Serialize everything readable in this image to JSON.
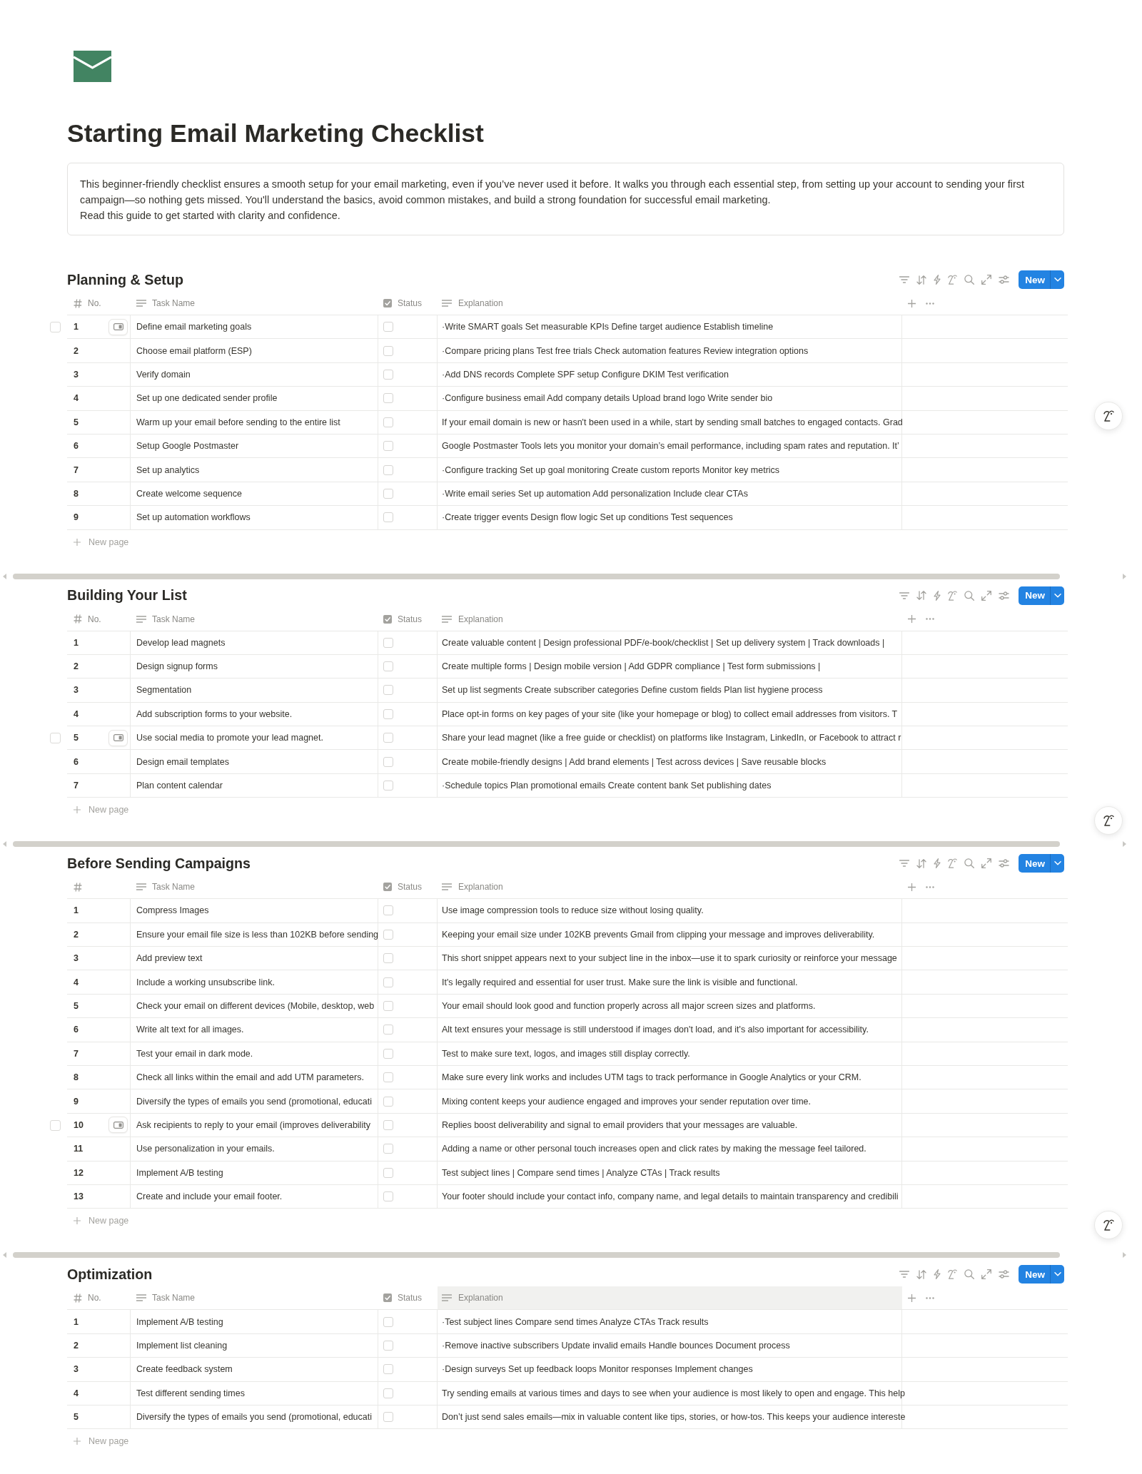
{
  "page": {
    "title": "Starting Email Marketing Checklist",
    "description": [
      "This beginner-friendly checklist ensures a smooth setup for your email marketing, even if you’ve never used it before. It walks you through each essential step, from setting up your account to sending your first campaign—so nothing gets missed. You'll understand the basics, avoid common mistakes, and build a strong foundation for successful email marketing.",
      "Read this guide to get started with clarity and confidence."
    ]
  },
  "tables": [
    {
      "title": "Planning & Setup",
      "new_button": "New",
      "new_page": "New page",
      "columns": [
        {
          "kind": "number",
          "label": "No.",
          "hovered": false
        },
        {
          "kind": "text",
          "label": "Task Name",
          "hovered": false
        },
        {
          "kind": "checkbox",
          "label": "Status",
          "hovered": false
        },
        {
          "kind": "text",
          "label": "Explanation",
          "hovered": false
        }
      ],
      "rows": [
        {
          "no": "1",
          "task": "Define email marketing goals",
          "checked": false,
          "selected": false,
          "explanation": "·Write SMART goals Set measurable KPIs Define target audience Establish timeline",
          "hovered": true
        },
        {
          "no": "2",
          "task": "Choose email platform (ESP)",
          "checked": false,
          "selected": false,
          "explanation": "·Compare pricing plans Test free trials Check automation features Review integration options",
          "hovered": false
        },
        {
          "no": "3",
          "task": "Verify domain",
          "checked": false,
          "selected": false,
          "explanation": "·Add DNS records Complete SPF setup Configure DKIM Test verification",
          "hovered": false
        },
        {
          "no": "4",
          "task": "Set up one dedicated sender profile",
          "checked": false,
          "selected": false,
          "explanation": "·Configure business email Add company details Upload brand logo Write sender bio",
          "hovered": false
        },
        {
          "no": "5",
          "task": "Warm up your email before sending to the entire list",
          "checked": false,
          "selected": false,
          "explanation": "If your email domain is new or hasn't been used in a while, start by sending small batches to engaged contacts. Grad",
          "hovered": false
        },
        {
          "no": "6",
          "task": "Setup Google Postmaster",
          "checked": false,
          "selected": false,
          "explanation": "Google Postmaster Tools lets you monitor your domain’s email performance, including spam rates and reputation. It’",
          "hovered": false
        },
        {
          "no": "7",
          "task": "Set up analytics",
          "checked": false,
          "selected": false,
          "explanation": "·Configure tracking Set up goal monitoring Create custom reports Monitor key metrics",
          "hovered": false
        },
        {
          "no": "8",
          "task": "Create welcome sequence",
          "checked": false,
          "selected": false,
          "explanation": "·Write email series Set up automation Add personalization Include clear CTAs",
          "hovered": false
        },
        {
          "no": "9",
          "task": "Set up automation workflows",
          "checked": false,
          "selected": false,
          "explanation": "·Create trigger events Design flow logic Set up conditions Test sequences",
          "hovered": false
        }
      ]
    },
    {
      "title": "Building Your List",
      "new_button": "New",
      "new_page": "New page",
      "columns": [
        {
          "kind": "number",
          "label": "No.",
          "hovered": false
        },
        {
          "kind": "text",
          "label": "Task Name",
          "hovered": false
        },
        {
          "kind": "checkbox",
          "label": "Status",
          "hovered": false
        },
        {
          "kind": "text",
          "label": "Explanation",
          "hovered": false
        }
      ],
      "rows": [
        {
          "no": "1",
          "task": "Develop lead magnets",
          "checked": false,
          "selected": false,
          "explanation": "Create valuable content | Design professional PDF/e-book/checklist | Set up delivery system | Track downloads |",
          "hovered": false
        },
        {
          "no": "2",
          "task": "Design signup forms",
          "checked": false,
          "selected": false,
          "explanation": "Create multiple forms | Design mobile version | Add GDPR compliance | Test form submissions |",
          "hovered": false
        },
        {
          "no": "3",
          "task": "Segmentation",
          "checked": false,
          "selected": false,
          "explanation": "Set up list segments Create subscriber categories Define custom fields Plan list hygiene process",
          "hovered": false
        },
        {
          "no": "4",
          "task": "Add subscription forms to your website.",
          "checked": false,
          "selected": false,
          "explanation": "Place opt-in forms on key pages of your site (like your homepage or blog) to collect email addresses from visitors. T",
          "hovered": false
        },
        {
          "no": "5",
          "task": "Use social media to promote your lead magnet.",
          "checked": false,
          "selected": false,
          "explanation": "Share your lead magnet (like a free guide or checklist) on platforms like Instagram, LinkedIn, or Facebook to attract r",
          "hovered": true
        },
        {
          "no": "6",
          "task": "Design email templates",
          "checked": false,
          "selected": false,
          "explanation": "Create mobile-friendly designs | Add brand elements | Test across devices | Save reusable blocks",
          "hovered": false
        },
        {
          "no": "7",
          "task": "Plan content calendar",
          "checked": false,
          "selected": false,
          "explanation": "·Schedule topics Plan promotional emails Create content bank Set publishing dates",
          "hovered": false
        }
      ]
    },
    {
      "title": "Before Sending Campaigns",
      "new_button": "New",
      "new_page": "New page",
      "columns": [
        {
          "kind": "number",
          "hovered": false
        },
        {
          "kind": "text",
          "label": "Task Name",
          "hovered": false
        },
        {
          "kind": "checkbox",
          "label": "Status",
          "hovered": false
        },
        {
          "kind": "text",
          "label": "Explanation",
          "hovered": false
        }
      ],
      "rows": [
        {
          "no": "1",
          "task": "Compress Images",
          "checked": false,
          "selected": false,
          "explanation": "Use image compression tools to reduce size without losing quality.",
          "hovered": false
        },
        {
          "no": "2",
          "task": "Ensure your email file size is less than 102KB before sending",
          "checked": false,
          "selected": false,
          "explanation": "Keeping your email size under 102KB prevents Gmail from clipping your message and improves deliverability.",
          "hovered": false
        },
        {
          "no": "3",
          "task": "Add preview text",
          "checked": false,
          "selected": false,
          "explanation": "This short snippet appears next to your subject line in the inbox—use it to spark curiosity or reinforce your message",
          "hovered": false
        },
        {
          "no": "4",
          "task": "Include a working unsubscribe link.",
          "checked": false,
          "selected": false,
          "explanation": "It's legally required and essential for user trust. Make sure the link is visible and functional.",
          "hovered": false
        },
        {
          "no": "5",
          "task": "Check your email on different devices (Mobile, desktop, web",
          "checked": false,
          "selected": false,
          "explanation": "Your email should look good and function properly across all major screen sizes and platforms.",
          "hovered": false
        },
        {
          "no": "6",
          "task": "Write alt text for all images.",
          "checked": false,
          "selected": false,
          "explanation": "Alt text ensures your message is still understood if images don't load, and it's also important for accessibility.",
          "hovered": false
        },
        {
          "no": "7",
          "task": "Test your email in dark mode.",
          "checked": false,
          "selected": false,
          "explanation": "Test to make sure text, logos, and images still display correctly.",
          "hovered": false
        },
        {
          "no": "8",
          "task": "Check all links within the email and add UTM parameters.",
          "checked": false,
          "selected": false,
          "explanation": "Make sure every link works and includes UTM tags to track performance in Google Analytics or your CRM.",
          "hovered": false
        },
        {
          "no": "9",
          "task": "Diversify the types of emails you send (promotional, educati",
          "checked": false,
          "selected": false,
          "explanation": "Mixing content keeps your audience engaged and improves your sender reputation over time.",
          "hovered": false
        },
        {
          "no": "10",
          "task": "Ask recipients to reply to your email (improves deliverability",
          "checked": false,
          "selected": false,
          "explanation": "Replies boost deliverability and signal to email providers that your messages are valuable.",
          "hovered": true
        },
        {
          "no": "11",
          "task": "Use personalization in your emails.",
          "checked": false,
          "selected": false,
          "explanation": "Adding a name or other personal touch increases open and click rates by making the message feel tailored.",
          "hovered": false
        },
        {
          "no": "12",
          "task": "Implement A/B testing",
          "checked": false,
          "selected": false,
          "explanation": "Test subject lines | Compare send times | Analyze CTAs | Track results",
          "hovered": false
        },
        {
          "no": "13",
          "task": "Create and include your email footer.",
          "checked": false,
          "selected": false,
          "explanation": "Your footer should include your contact info, company name, and legal details to maintain transparency and credibili",
          "hovered": false
        }
      ]
    },
    {
      "title": "Optimization",
      "new_button": "New",
      "new_page": "New page",
      "columns": [
        {
          "kind": "number",
          "label": "No.",
          "hovered": false
        },
        {
          "kind": "text",
          "label": "Task Name",
          "hovered": false
        },
        {
          "kind": "checkbox",
          "label": "Status",
          "hovered": false
        },
        {
          "kind": "text",
          "label": "Explanation",
          "hovered": true
        }
      ],
      "rows": [
        {
          "no": "1",
          "task": "Implement A/B testing",
          "checked": false,
          "selected": false,
          "explanation": "·Test subject lines Compare send times Analyze CTAs Track results",
          "hovered": false
        },
        {
          "no": "2",
          "task": "Implement list cleaning",
          "checked": false,
          "selected": false,
          "explanation": "·Remove inactive subscribers Update invalid emails Handle bounces Document process",
          "hovered": false
        },
        {
          "no": "3",
          "task": "Create feedback system",
          "checked": false,
          "selected": false,
          "explanation": "·Design surveys Set up feedback loops Monitor responses Implement changes",
          "hovered": false
        },
        {
          "no": "4",
          "task": "Test different sending times",
          "checked": false,
          "selected": false,
          "explanation": "Try sending emails at various times and days to see when your audience is most likely to open and engage. This help",
          "hovered": false
        },
        {
          "no": "5",
          "task": "Diversify the types of emails you send (promotional, educati",
          "checked": false,
          "selected": false,
          "explanation": "Don’t just send sales emails—mix in valuable content like tips, stories, or how-tos. This keeps your audience intereste",
          "hovered": false
        }
      ]
    }
  ]
}
